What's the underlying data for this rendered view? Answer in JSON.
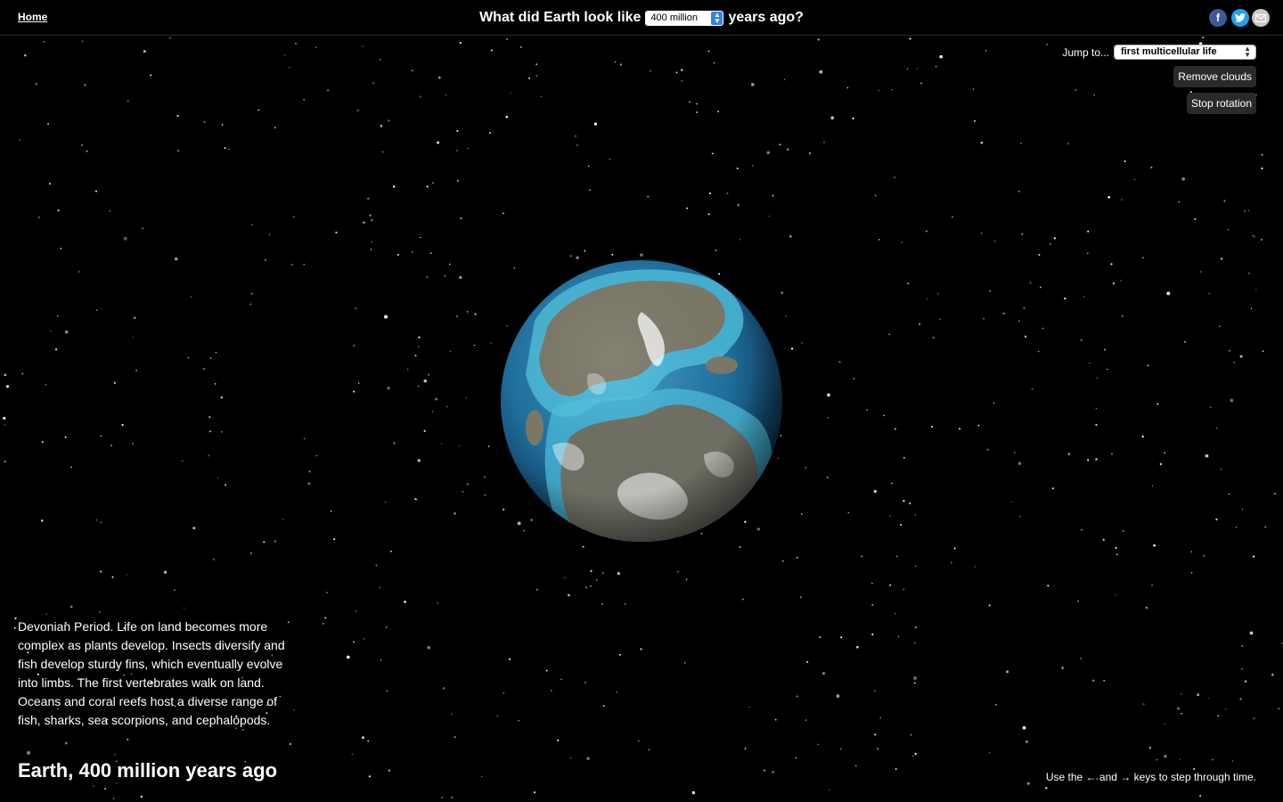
{
  "header": {
    "home_label": "Home",
    "question_prefix": "What did Earth look like",
    "selected_age": "400 million",
    "question_suffix": "years ago?",
    "share": {
      "facebook_icon": "facebook-icon",
      "twitter_icon": "twitter-icon",
      "email_icon": "email-icon"
    }
  },
  "controls": {
    "jump_label": "Jump to...",
    "jump_selected": "first multicellular life",
    "remove_clouds_label": "Remove clouds",
    "stop_rotation_label": "Stop rotation"
  },
  "globe": {
    "ocean_color": "#1f6f9e",
    "land_color": "#7b7868",
    "shallow_color": "#4fc0dd"
  },
  "description": "Devonian Period. Life on land becomes more complex as plants develop. Insects diversify and fish develop sturdy fins, which eventually evolve into limbs. The first vertebrates walk on land. Oceans and coral reefs host a diverse range of fish, sharks, sea scorpions, and cephalopods.",
  "title": "Earth, 400 million years ago",
  "hint": "Use the ← and → keys to step through time."
}
